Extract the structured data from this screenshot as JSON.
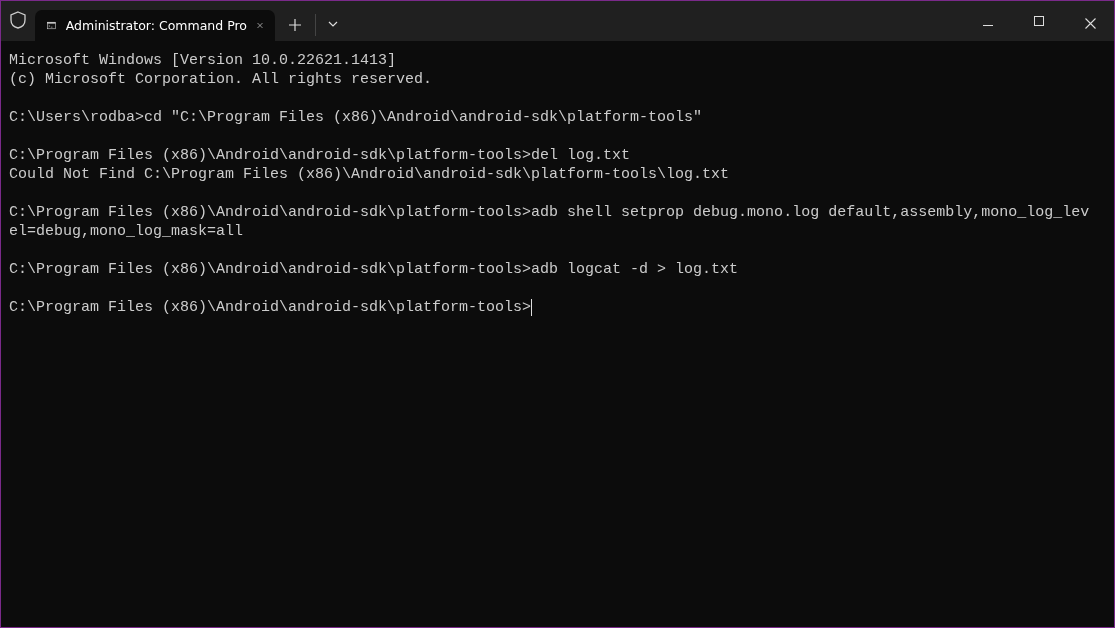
{
  "window": {
    "tabs": [
      {
        "title": "Administrator: Command Pro",
        "selected": true
      }
    ]
  },
  "terminal": {
    "blocks": [
      {
        "lines": [
          "Microsoft Windows [Version 10.0.22621.1413]",
          "(c) Microsoft Corporation. All rights reserved."
        ]
      },
      {
        "lines": [
          "C:\\Users\\rodba>cd \"C:\\Program Files (x86)\\Android\\android-sdk\\platform-tools\""
        ]
      },
      {
        "lines": [
          "C:\\Program Files (x86)\\Android\\android-sdk\\platform-tools>del log.txt",
          "Could Not Find C:\\Program Files (x86)\\Android\\android-sdk\\platform-tools\\log.txt"
        ]
      },
      {
        "lines": [
          "C:\\Program Files (x86)\\Android\\android-sdk\\platform-tools>adb shell setprop debug.mono.log default,assembly,mono_log_lev",
          "el=debug,mono_log_mask=all"
        ]
      },
      {
        "lines": [
          "C:\\Program Files (x86)\\Android\\android-sdk\\platform-tools>adb logcat -d > log.txt"
        ]
      },
      {
        "lines": [
          "C:\\Program Files (x86)\\Android\\android-sdk\\platform-tools>"
        ]
      }
    ],
    "cursor": true
  }
}
